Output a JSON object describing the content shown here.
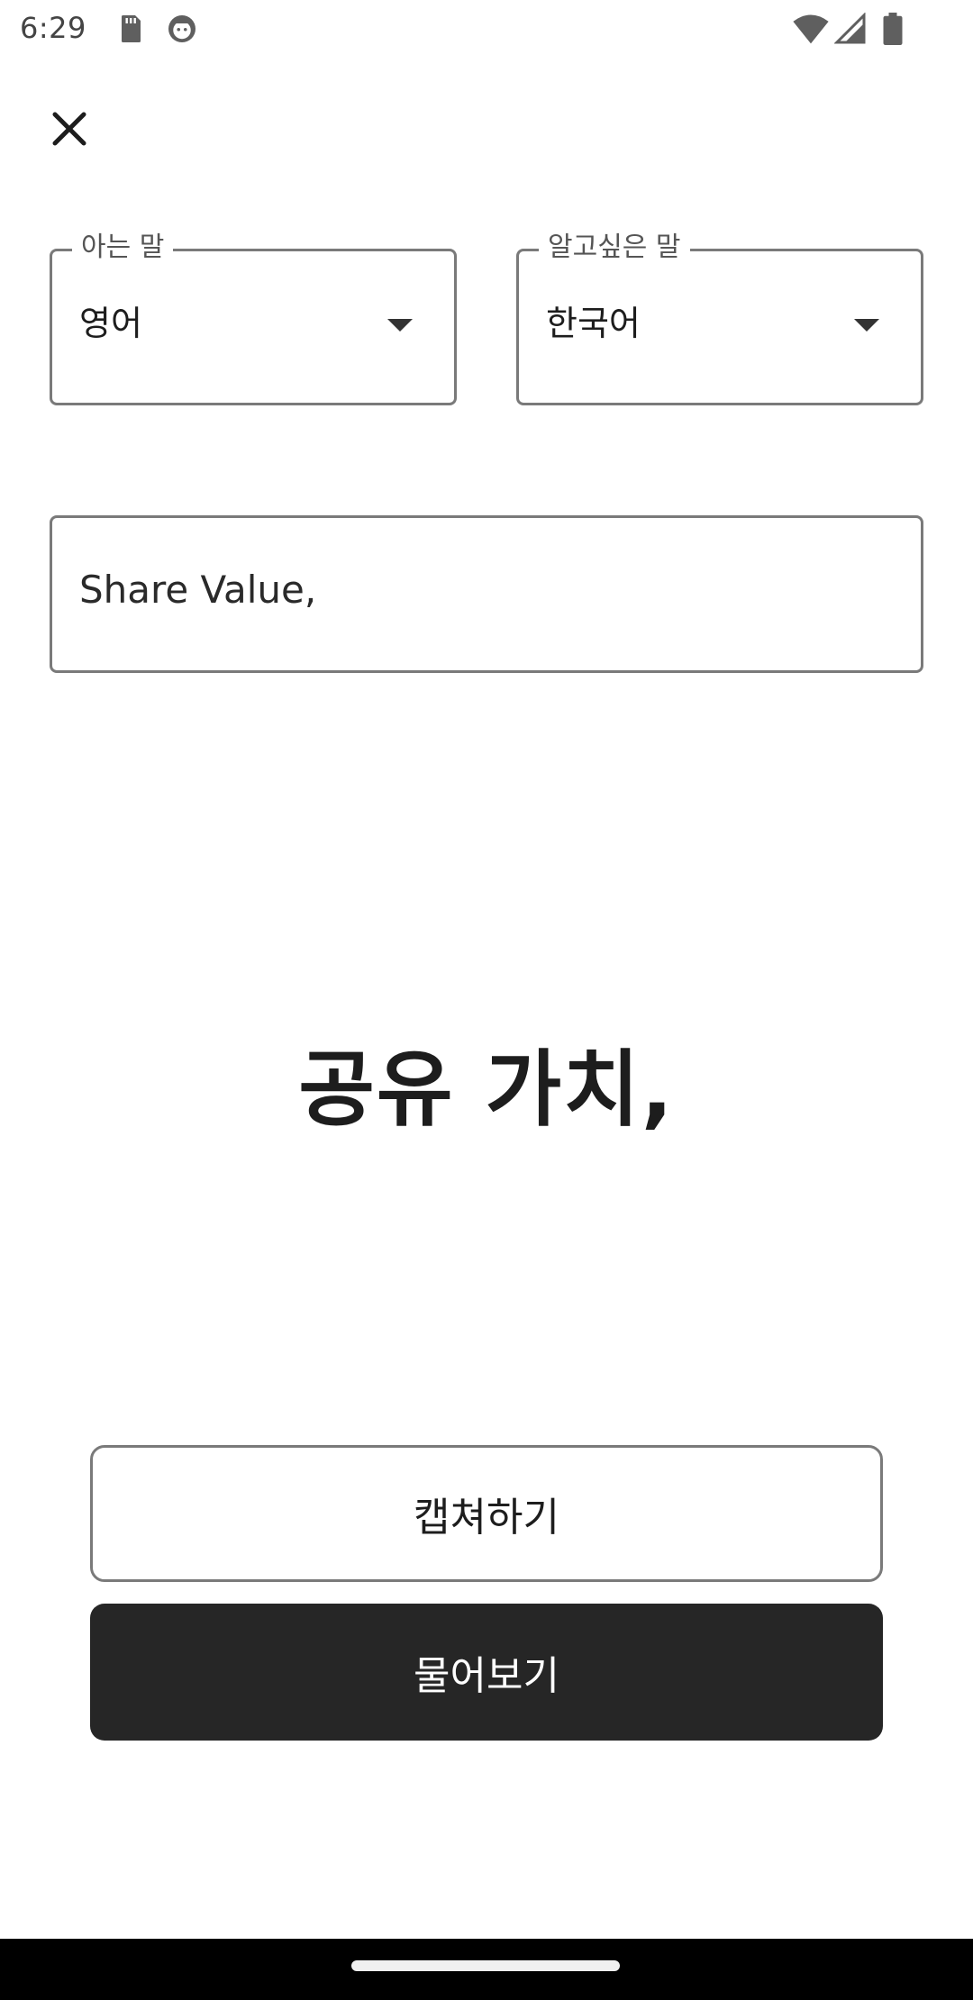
{
  "status_bar": {
    "time": "6:29",
    "icons": [
      "sd-card-icon",
      "face-icon",
      "wifi-icon",
      "signal-icon",
      "battery-icon"
    ]
  },
  "header": {
    "close_icon": "close-icon"
  },
  "source_language": {
    "label": "아는 말",
    "value": "영어"
  },
  "target_language": {
    "label": "알고싶은 말",
    "value": "한국어"
  },
  "input": {
    "value": "Share Value,"
  },
  "result": {
    "text": "공유 가치,"
  },
  "actions": {
    "capture_label": "캡쳐하기",
    "ask_label": "물어보기"
  },
  "colors": {
    "border": "#7a7a7a",
    "primary_button": "#262626",
    "text": "#1d1d1d",
    "nav_bar": "#000000"
  }
}
